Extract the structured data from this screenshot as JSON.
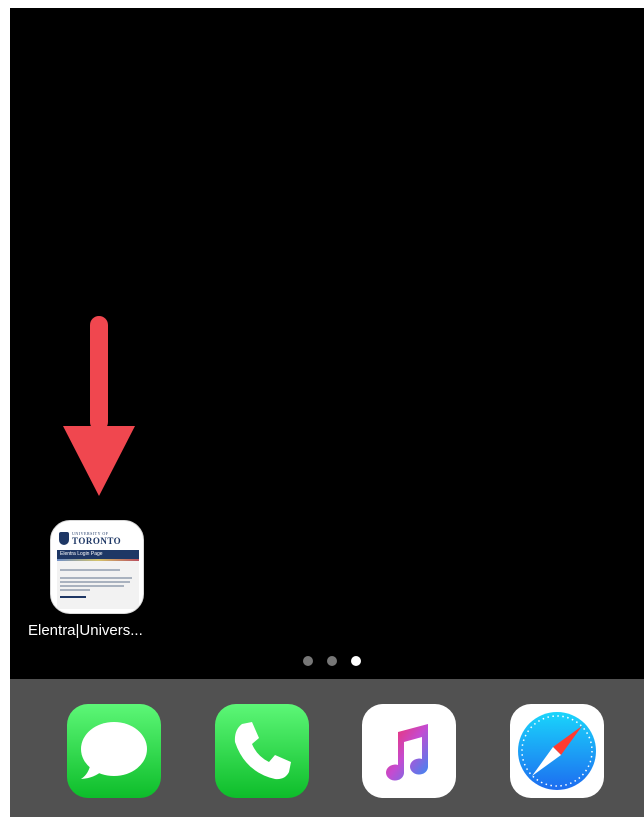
{
  "home_screen": {
    "app": {
      "label": "Elentra|Univers...",
      "icon": "elentra-university-of-toronto-icon",
      "thumbnail": {
        "university": "UNIVERSITY OF",
        "name": "TORONTO",
        "bar_title": "Elentra Login Page"
      }
    },
    "annotation": {
      "icon": "arrow-down-icon",
      "color": "#f0474f"
    },
    "page_dots": {
      "count": 3,
      "active": 3
    }
  },
  "dock": {
    "apps": [
      {
        "name": "Messages",
        "icon": "messages-icon"
      },
      {
        "name": "Phone",
        "icon": "phone-icon"
      },
      {
        "name": "Music",
        "icon": "music-icon"
      },
      {
        "name": "Safari",
        "icon": "safari-icon"
      }
    ]
  },
  "colors": {
    "screen_background": "#000000",
    "dock_background": "#515151",
    "messages_green": "#35d25a",
    "phone_green": "#35d25a",
    "safari_blue": "#1f8ff4"
  }
}
